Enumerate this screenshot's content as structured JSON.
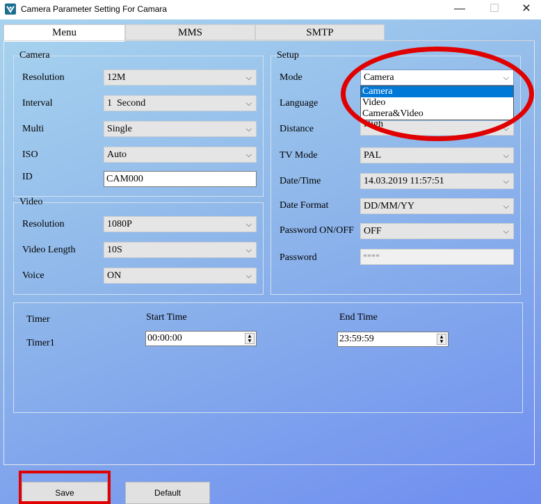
{
  "window": {
    "title": "Camera Parameter Setting For  Camara",
    "minimize": "—",
    "maximize": "☐",
    "close": "✕"
  },
  "tabs": [
    {
      "label": "Menu"
    },
    {
      "label": "MMS"
    },
    {
      "label": "SMTP"
    }
  ],
  "camera": {
    "group_label": "Camera",
    "resolution": {
      "label": "Resolution",
      "value": "12M"
    },
    "interval": {
      "label": "Interval",
      "value": "1  Second"
    },
    "multi": {
      "label": "Multi",
      "value": "Single"
    },
    "iso": {
      "label": "ISO",
      "value": "Auto"
    },
    "id": {
      "label": "ID",
      "value": "CAM000"
    }
  },
  "video": {
    "group_label": "Video",
    "resolution": {
      "label": "Resolution",
      "value": "1080P"
    },
    "length": {
      "label": "Video Length",
      "value": "10S"
    },
    "voice": {
      "label": "Voice",
      "value": "ON"
    }
  },
  "setup": {
    "group_label": "Setup",
    "mode": {
      "label": "Mode",
      "value": "Camera",
      "options": [
        "Camera",
        "Video",
        "Camera&Video"
      ],
      "selected_index": 0
    },
    "language": {
      "label": "Language"
    },
    "distance": {
      "label": "Distance",
      "value": "High"
    },
    "tv_mode": {
      "label": "TV Mode",
      "value": "PAL"
    },
    "datetime": {
      "label": "Date/Time",
      "value": "14.03.2019 11:57:51"
    },
    "date_format": {
      "label": "Date Format",
      "value": "DD/MM/YY"
    },
    "password_onoff": {
      "label": "Password ON/OFF",
      "value": "OFF"
    },
    "password": {
      "label": "Password",
      "value": "****"
    }
  },
  "timer": {
    "label": "Timer",
    "row_label": "Timer1",
    "start_label": "Start Time",
    "start_value": "00:00:00",
    "end_label": "End Time",
    "end_value": "23:59:59"
  },
  "buttons": {
    "save": "Save",
    "default": "Default"
  },
  "icons": {
    "dropdown": "chevron-down-icon",
    "spin_up": "▲",
    "spin_down": "▼",
    "chevron": "⌵"
  },
  "colors": {
    "highlight_red": "#e00000",
    "selection_blue": "#0078d7"
  }
}
